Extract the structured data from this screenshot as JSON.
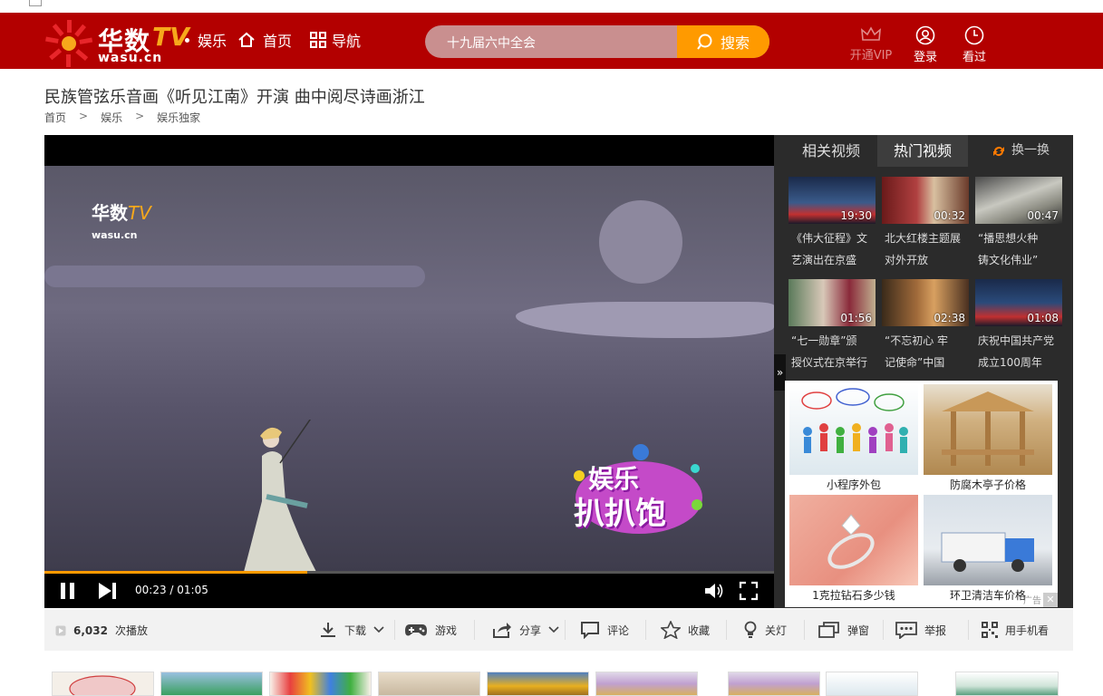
{
  "header": {
    "logo_cn": "华数",
    "logo_tv": "TV",
    "logo_url": "wasu.cn",
    "channel": "娱乐",
    "home": "首页",
    "guide": "导航",
    "search_value": "十九届六中全会",
    "search_button": "搜索",
    "vip": "开通VIP",
    "login": "登录",
    "history": "看过"
  },
  "page": {
    "title": "民族管弦乐音画《听见江南》开演 曲中阅尽诗画浙江",
    "breadcrumbs": [
      "首页",
      "娱乐",
      "娱乐独家"
    ],
    "breadcrumb_sep": ">"
  },
  "player": {
    "watermark_cn": "华数",
    "watermark_tv": "TV",
    "watermark_url": "wasu.cn",
    "badge_line1": "娱乐",
    "badge_line2": "扒扒饱",
    "time": "00:23 / 01:05",
    "progress": 0.36
  },
  "sidebar": {
    "tabs": [
      "相关视频",
      "热门视频"
    ],
    "active_tab": 1,
    "refresh": "换一换",
    "expand": "»",
    "videos": [
      {
        "duration": "19:30",
        "line1": "《伟大征程》文",
        "line2": "艺演出在京盛"
      },
      {
        "duration": "00:32",
        "line1": "北大红楼主题展",
        "line2": "对外开放"
      },
      {
        "duration": "00:47",
        "line1": "“播思想火种",
        "line2": "铸文化伟业”"
      },
      {
        "duration": "01:56",
        "line1": "“七一勋章”颁",
        "line2": "授仪式在京举行"
      },
      {
        "duration": "02:38",
        "line1": "“不忘初心 牢",
        "line2": "记使命”中国"
      },
      {
        "duration": "01:08",
        "line1": "庆祝中国共产党",
        "line2": "成立100周年"
      }
    ]
  },
  "ad": {
    "items": [
      "小程序外包",
      "防腐木亭子价格",
      "1克拉钻石多少钱",
      "环卫清洁车价格"
    ],
    "tag": "广告",
    "close": "✕"
  },
  "actions": {
    "play_count": "6,032",
    "play_suffix": "次播放",
    "download": "下载",
    "game": "游戏",
    "share": "分享",
    "comment": "评论",
    "favorite": "收藏",
    "lights": "关灯",
    "popup": "弹窗",
    "report": "举报",
    "mobile": "用手机看"
  },
  "colors": {
    "header_bg": "#b30000",
    "accent": "#ff9a00",
    "search_bg": "#c98f8f",
    "sidebar_bg": "#2b2b2b"
  }
}
